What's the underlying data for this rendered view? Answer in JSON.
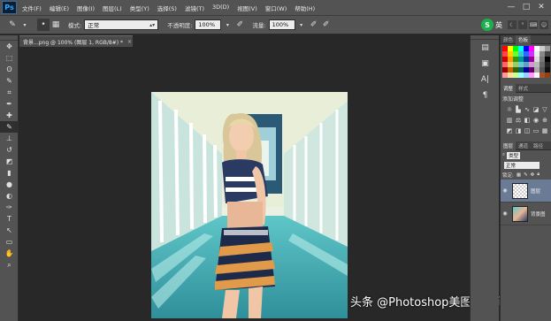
{
  "app": {
    "logo": "Ps"
  },
  "menu": [
    "文件(F)",
    "编辑(E)",
    "图像(I)",
    "图层(L)",
    "类型(Y)",
    "选择(S)",
    "滤镜(T)",
    "3D(D)",
    "视图(V)",
    "窗口(W)",
    "帮助(H)"
  ],
  "window_controls": [
    "—",
    "□",
    "✕"
  ],
  "options": {
    "mode_label": "模式:",
    "mode_value": "正常",
    "opacity_label": "不透明度:",
    "opacity_value": "100%",
    "flow_label": "流量:",
    "flow_value": "100%"
  },
  "ime": {
    "logo": "S",
    "text": "英"
  },
  "document_tab": {
    "title": "背景...png @ 100% (图层 1, RGB/8#) *",
    "close": "×"
  },
  "tools": [
    "move-tool",
    "marquee-tool",
    "lasso-tool",
    "quick-select-tool",
    "crop-tool",
    "eyedropper-tool",
    "healing-brush-tool",
    "brush-tool",
    "clone-stamp-tool",
    "history-brush-tool",
    "eraser-tool",
    "gradient-tool",
    "blur-tool",
    "dodge-tool",
    "pen-tool",
    "type-tool",
    "path-select-tool",
    "shape-tool",
    "hand-tool",
    "zoom-tool"
  ],
  "tool_glyphs": [
    "✥",
    "⬚",
    "ʘ",
    "✎",
    "⌗",
    "✒",
    "✚",
    "✎",
    "⊥",
    "↺",
    "◩",
    "▮",
    "●",
    "◐",
    "✑",
    "T",
    "↖",
    "▭",
    "✋",
    "⌕"
  ],
  "panels": {
    "color_tabs": [
      "颜色",
      "色板"
    ],
    "adjust_tabs": [
      "调整",
      "样式"
    ],
    "adjust_label": "添加调整",
    "layers_tabs": [
      "图层",
      "通道",
      "路径"
    ],
    "kind_label": "类型",
    "blend_mode": "正常",
    "lock_label": "锁定:",
    "layers": [
      {
        "name": "图层",
        "selected": true
      },
      {
        "name": "背景图",
        "selected": false
      }
    ]
  },
  "watermark": "头条 @Photoshop美图设计师",
  "swatch_colors": [
    "#ff0000",
    "#ffff00",
    "#00ff00",
    "#00ffff",
    "#0000ff",
    "#ff00ff",
    "#ffffff",
    "#cccccc",
    "#999999",
    "#ff4444",
    "#ffcc00",
    "#66ff33",
    "#33cccc",
    "#3366ff",
    "#cc33ff",
    "#eeeeee",
    "#888888",
    "#444444",
    "#cc0000",
    "#ff9900",
    "#339900",
    "#009999",
    "#003399",
    "#990099",
    "#dddddd",
    "#777777",
    "#000000",
    "#ff6666",
    "#ffcc66",
    "#99cc66",
    "#66cccc",
    "#6699cc",
    "#cc99cc",
    "#bbbbbb",
    "#666666",
    "#222222",
    "#990000",
    "#cc6600",
    "#336600",
    "#006666",
    "#000099",
    "#660066",
    "#aaaaaa",
    "#555555",
    "#111111",
    "#ff9999",
    "#ffe0a0",
    "#ccff99",
    "#99ffff",
    "#99ccff",
    "#ff99ff",
    "#f5f5f5",
    "#a0522d",
    "#8b4513"
  ]
}
